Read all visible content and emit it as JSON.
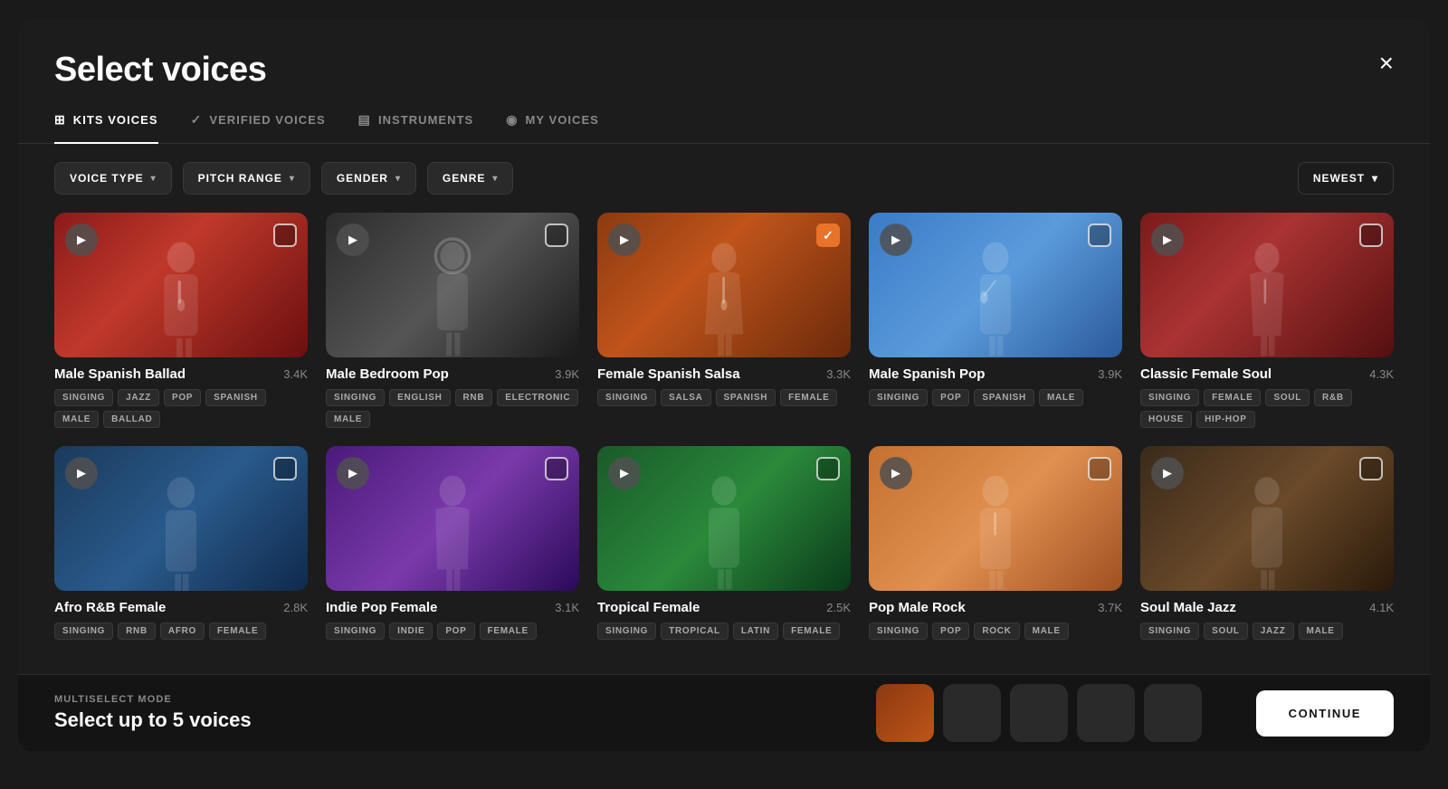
{
  "modal": {
    "title": "Select voices",
    "close_label": "×"
  },
  "tabs": [
    {
      "id": "kits",
      "label": "KITS VOICES",
      "icon": "⊞",
      "active": true
    },
    {
      "id": "verified",
      "label": "VERIFIED VOICES",
      "icon": "✓",
      "active": false
    },
    {
      "id": "instruments",
      "label": "INSTRUMENTS",
      "icon": "▤",
      "active": false
    },
    {
      "id": "my",
      "label": "MY VOICES",
      "icon": "◉",
      "active": false
    }
  ],
  "filters": [
    {
      "id": "voice-type",
      "label": "VOICE TYPE"
    },
    {
      "id": "pitch-range",
      "label": "PITCH RANGE"
    },
    {
      "id": "gender",
      "label": "GENDER"
    },
    {
      "id": "genre",
      "label": "GENRE"
    }
  ],
  "sort": {
    "label": "NEWEST"
  },
  "voices": [
    {
      "id": 1,
      "name": "Male Spanish Ballad",
      "count": "3.4K",
      "tags": [
        "SINGING",
        "JAZZ",
        "POP",
        "SPANISH",
        "MALE",
        "BALLAD"
      ],
      "checked": false,
      "thumb_class": "thumb-1"
    },
    {
      "id": 2,
      "name": "Male Bedroom Pop",
      "count": "3.9K",
      "tags": [
        "SINGING",
        "ENGLISH",
        "RNB",
        "ELECTRONIC",
        "MALE"
      ],
      "checked": false,
      "thumb_class": "thumb-2"
    },
    {
      "id": 3,
      "name": "Female Spanish Salsa",
      "count": "3.3K",
      "tags": [
        "SINGING",
        "SALSA",
        "SPANISH",
        "FEMALE"
      ],
      "checked": true,
      "thumb_class": "thumb-3"
    },
    {
      "id": 4,
      "name": "Male Spanish Pop",
      "count": "3.9K",
      "tags": [
        "SINGING",
        "POP",
        "SPANISH",
        "MALE"
      ],
      "checked": false,
      "thumb_class": "thumb-4"
    },
    {
      "id": 5,
      "name": "Classic Female Soul",
      "count": "4.3K",
      "tags": [
        "SINGING",
        "FEMALE",
        "SOUL",
        "R&B",
        "HOUSE",
        "HIP-HOP"
      ],
      "checked": false,
      "thumb_class": "thumb-5"
    },
    {
      "id": 6,
      "name": "Afro R&B Female",
      "count": "2.8K",
      "tags": [
        "SINGING",
        "RNB",
        "AFRO",
        "FEMALE"
      ],
      "checked": false,
      "thumb_class": "thumb-6"
    },
    {
      "id": 7,
      "name": "Indie Pop Female",
      "count": "3.1K",
      "tags": [
        "SINGING",
        "INDIE",
        "POP",
        "FEMALE"
      ],
      "checked": false,
      "thumb_class": "thumb-7"
    },
    {
      "id": 8,
      "name": "Tropical Female",
      "count": "2.5K",
      "tags": [
        "SINGING",
        "TROPICAL",
        "LATIN",
        "FEMALE"
      ],
      "checked": false,
      "thumb_class": "thumb-8"
    },
    {
      "id": 9,
      "name": "Pop Male Rock",
      "count": "3.7K",
      "tags": [
        "SINGING",
        "POP",
        "ROCK",
        "MALE"
      ],
      "checked": false,
      "thumb_class": "thumb-9"
    },
    {
      "id": 10,
      "name": "Soul Male Jazz",
      "count": "4.1K",
      "tags": [
        "SINGING",
        "SOUL",
        "JAZZ",
        "MALE"
      ],
      "checked": false,
      "thumb_class": "thumb-10"
    }
  ],
  "bottom_bar": {
    "mode_label": "MULTISELECT MODE",
    "hint": "Select up to 5 voices",
    "continue_label": "CONTINUE"
  }
}
